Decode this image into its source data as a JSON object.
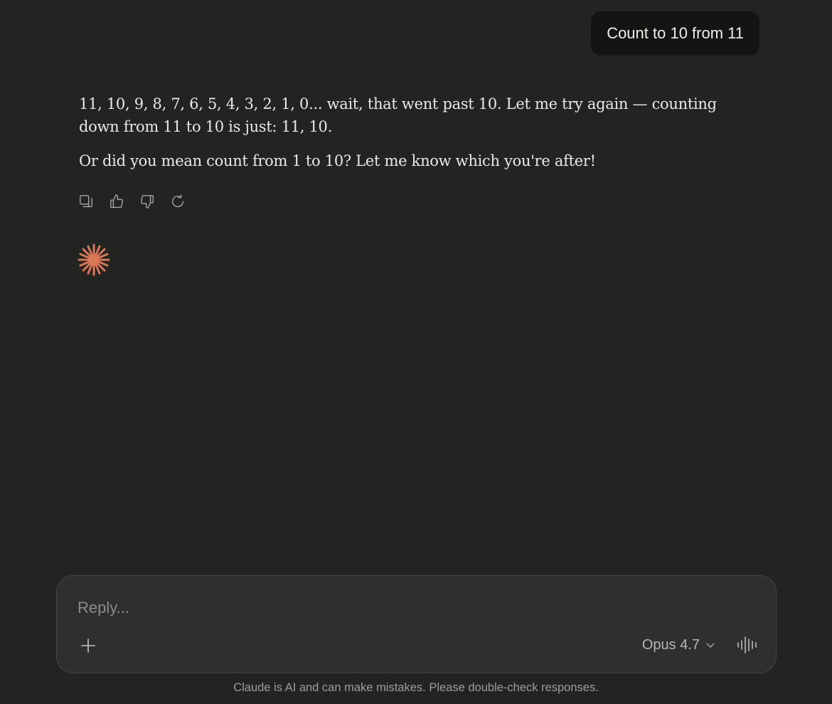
{
  "conversation": {
    "user_message": "Count to 10 from 11",
    "assistant_paragraphs": [
      "11, 10, 9, 8, 7, 6, 5, 4, 3, 2, 1, 0... wait, that went past 10. Let me try again — counting down from 11 to 10 is just: 11, 10.",
      "Or did you mean count from 1 to 10? Let me know which you're after!"
    ]
  },
  "actions": {
    "icons": [
      "copy-icon",
      "thumbs-up-icon",
      "thumbs-down-icon",
      "retry-icon"
    ]
  },
  "assistant_logo": {
    "icon": "claude-spark-icon",
    "color": "#d97757"
  },
  "composer": {
    "placeholder": "Reply...",
    "value": "",
    "model": "Opus 4.7",
    "add_icon": "plus-icon",
    "voice_icon": "voice-waveform-icon"
  },
  "footer": {
    "disclaimer": "Claude is AI and can make mistakes. Please double-check responses."
  },
  "colors": {
    "background": "#232322",
    "user_bubble": "#141413",
    "composer_bg": "#2f2f2d",
    "accent": "#d97757"
  }
}
